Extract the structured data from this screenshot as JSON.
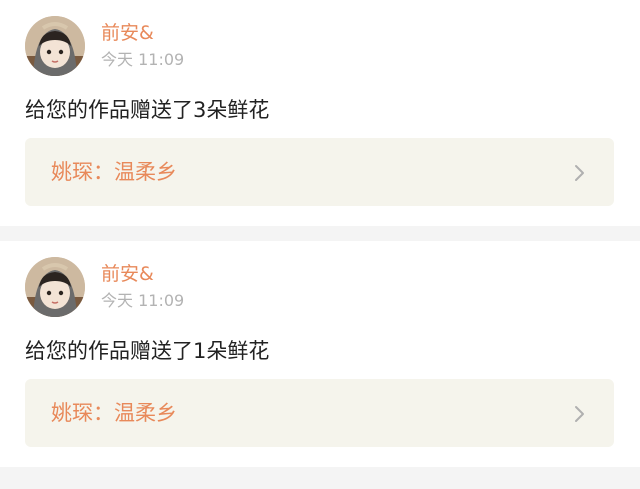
{
  "notifications": [
    {
      "username": "前安&",
      "time": "今天 11:09",
      "message": "给您的作品赠送了3朵鲜花",
      "work_title": "姚琛：温柔乡"
    },
    {
      "username": "前安&",
      "time": "今天 11:09",
      "message": "给您的作品赠送了1朵鲜花",
      "work_title": "姚琛：温柔乡"
    }
  ],
  "colors": {
    "accent": "#e8895a",
    "card_background": "#ffffff",
    "work_box_background": "#f5f4ec",
    "page_background": "#f4f4f4",
    "muted_text": "#b3b3b3"
  },
  "icons": {
    "chevron": "chevron-right-icon",
    "avatar": "user-avatar-photo"
  }
}
